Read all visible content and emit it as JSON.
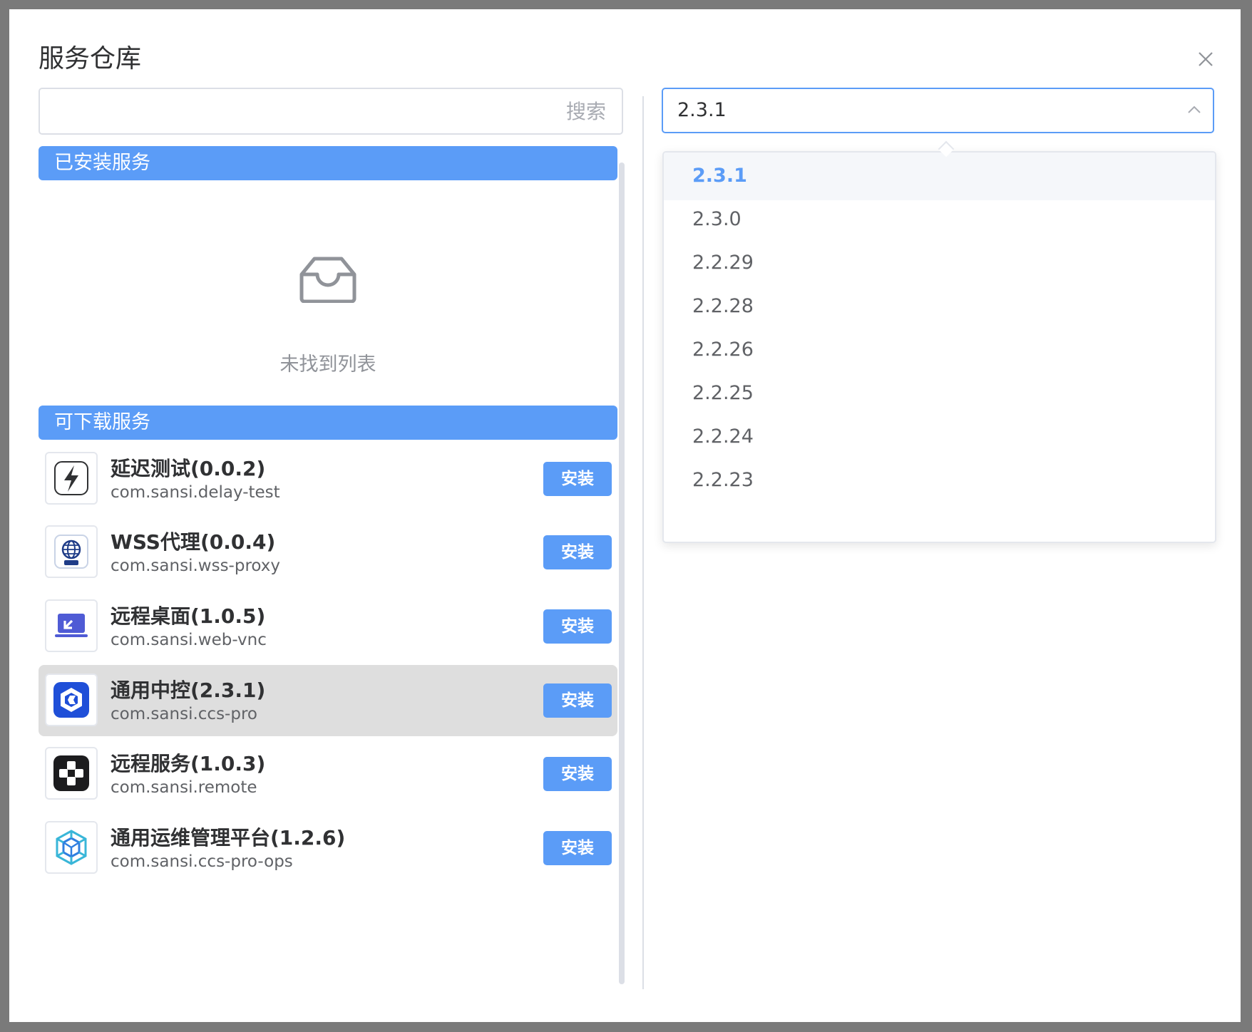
{
  "dialog": {
    "title": "服务仓库"
  },
  "search": {
    "placeholder": "搜索",
    "value": ""
  },
  "installed": {
    "header": "已安装服务",
    "empty_text": "未找到列表"
  },
  "downloadable": {
    "header": "可下载服务",
    "install_label": "安装",
    "items": [
      {
        "name": "延迟测试(0.0.2)",
        "package": "com.sansi.delay-test",
        "icon": "lightning-icon"
      },
      {
        "name": "WSS代理(0.0.4)",
        "package": "com.sansi.wss-proxy",
        "icon": "globe-icon"
      },
      {
        "name": "远程桌面(1.0.5)",
        "package": "com.sansi.web-vnc",
        "icon": "laptop-icon"
      },
      {
        "name": "通用中控(2.3.1)",
        "package": "com.sansi.ccs-pro",
        "icon": "hexagon-icon",
        "highlighted": true
      },
      {
        "name": "远程服务(1.0.3)",
        "package": "com.sansi.remote",
        "icon": "gamepad-icon"
      },
      {
        "name": "通用运维管理平台(1.2.6)",
        "package": "com.sansi.ccs-pro-ops",
        "icon": "cube-icon"
      }
    ]
  },
  "version_select": {
    "value": "2.3.1",
    "options": [
      "2.3.1",
      "2.3.0",
      "2.2.29",
      "2.2.28",
      "2.2.26",
      "2.2.25",
      "2.2.24",
      "2.2.23"
    ]
  },
  "colors": {
    "accent": "#5b9cf7",
    "highlight_row": "#dedede",
    "overlay": "#7a7a7a"
  }
}
